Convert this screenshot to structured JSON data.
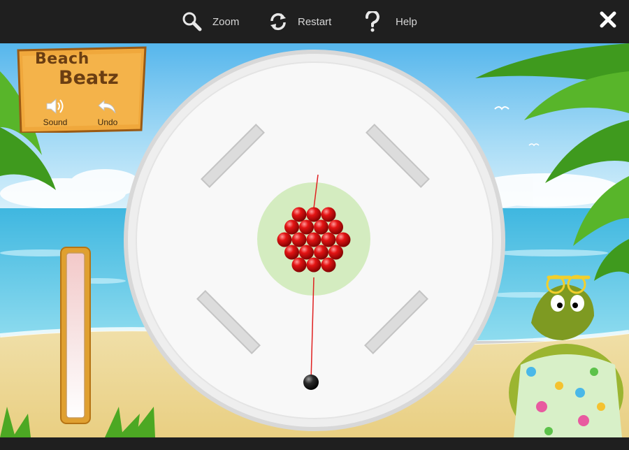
{
  "toolbar": {
    "zoom_label": "Zoom",
    "restart_label": "Restart",
    "help_label": "Help"
  },
  "game": {
    "title_line1": "Beach",
    "title_line2": "Beatz",
    "sound_label": "Sound",
    "undo_label": "Undo",
    "power_level": 0
  },
  "colors": {
    "topbar": "#1f1f1f",
    "ball_red": "#d40000",
    "aim_line": "#e02020",
    "center_zone": "#d4ecc0",
    "sign_wood": "#f0a83c",
    "board": "#f6f6f6"
  }
}
